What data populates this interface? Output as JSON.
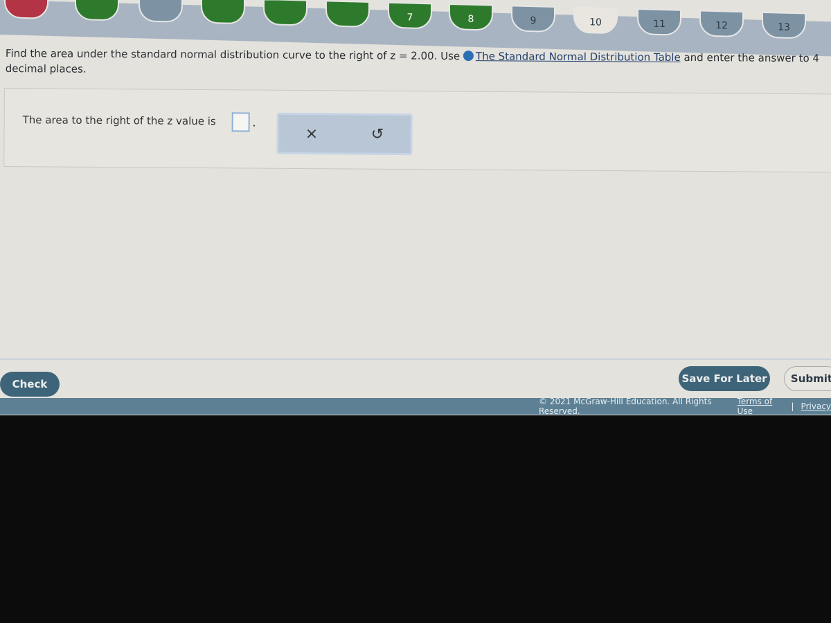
{
  "nav": {
    "items": [
      {
        "label": "",
        "status": "incorrect",
        "color": "#b23445"
      },
      {
        "label": "",
        "status": "answered",
        "color": "#2e7a2c"
      },
      {
        "label": "",
        "status": "partial",
        "color": "#7d93a4"
      },
      {
        "label": "",
        "status": "answered",
        "color": "#2e7a2c"
      },
      {
        "label": "",
        "status": "answered",
        "color": "#2e7a2c"
      },
      {
        "label": "",
        "status": "answered",
        "color": "#2e7a2c"
      },
      {
        "label": "7",
        "status": "answered",
        "color": "#2e7a2c"
      },
      {
        "label": "8",
        "status": "answered",
        "color": "#2e7a2c"
      },
      {
        "label": "9",
        "status": "unanswered",
        "color": "#7d93a4"
      },
      {
        "label": "10",
        "status": "current",
        "color": "#e8e6de"
      },
      {
        "label": "11",
        "status": "unanswered",
        "color": "#7d93a4"
      },
      {
        "label": "12",
        "status": "unanswered",
        "color": "#7d93a4"
      },
      {
        "label": "13",
        "status": "unanswered",
        "color": "#7d93a4"
      }
    ]
  },
  "question": {
    "text_before": "Find the area under the standard normal distribution curve to the right of z = 2.00. Use",
    "link": "The Standard Normal Distribution Table",
    "text_after": "and enter the answer to 4 decimal places."
  },
  "answer": {
    "label": "The area to the right of the z value is",
    "value": "",
    "suffix": "."
  },
  "tools": {
    "clear_icon": "×",
    "reset_icon": "↺"
  },
  "buttons": {
    "check": "Check",
    "save": "Save For Later",
    "submit": "Submit"
  },
  "footer": {
    "copyright": "© 2021 McGraw-Hill Education. All Rights Reserved.",
    "terms": "Terms of Use",
    "separator": "|",
    "privacy": "Privacy"
  }
}
